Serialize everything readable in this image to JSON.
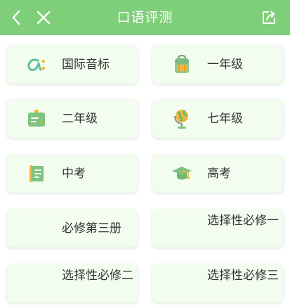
{
  "header": {
    "title": "口语评测",
    "back_icon": "chevron-left-icon",
    "close_icon": "close-icon",
    "share_icon": "share-icon",
    "background": "#7fce79"
  },
  "cards": [
    {
      "label": "国际音标",
      "icon": "alpha-phonetic-icon"
    },
    {
      "label": "一年级",
      "icon": "backpack-icon"
    },
    {
      "label": "二年级",
      "icon": "blackboard-icon"
    },
    {
      "label": "七年级",
      "icon": "globe-icon"
    },
    {
      "label": "中考",
      "icon": "scroll-icon"
    },
    {
      "label": "高考",
      "icon": "graduation-cap-icon"
    },
    {
      "label": "必修第三册"
    },
    {
      "label": "选择性必修一"
    },
    {
      "label": "选择性必修二"
    },
    {
      "label": "选择性必修三"
    }
  ]
}
